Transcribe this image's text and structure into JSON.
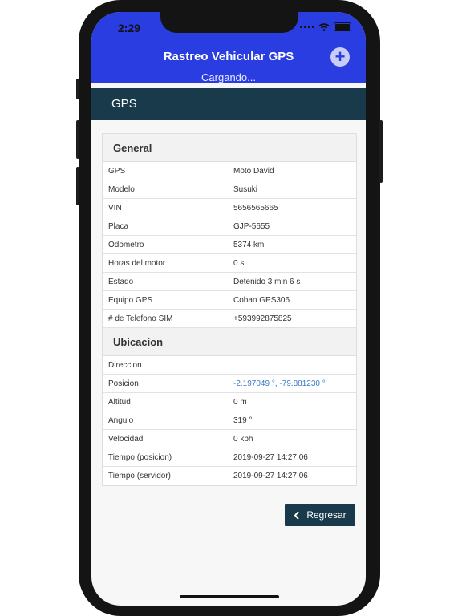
{
  "status_bar": {
    "time": "2:29"
  },
  "header": {
    "title": "Rastreo Vehicular GPS",
    "loading": "Cargando...",
    "add_icon": "plus-circle-icon"
  },
  "subheader": {
    "title": "GPS"
  },
  "sections": {
    "general": {
      "title": "General",
      "rows": [
        {
          "key": "GPS",
          "value": "Moto David"
        },
        {
          "key": "Modelo",
          "value": "Susuki"
        },
        {
          "key": "VIN",
          "value": "5656565665"
        },
        {
          "key": "Placa",
          "value": "GJP-5655"
        },
        {
          "key": "Odometro",
          "value": "5374 km"
        },
        {
          "key": "Horas del motor",
          "value": "0 s"
        },
        {
          "key": "Estado",
          "value": "Detenido 3 min 6 s"
        },
        {
          "key": "Equipo GPS",
          "value": "Coban GPS306"
        },
        {
          "key": "# de Telefono SIM",
          "value": "+593992875825"
        }
      ]
    },
    "ubicacion": {
      "title": "Ubicacion",
      "rows": [
        {
          "key": "Direccion",
          "value": ""
        },
        {
          "key": "Posicion",
          "value": "-2.197049 °, -79.881230 °"
        },
        {
          "key": "Altitud",
          "value": "0 m"
        },
        {
          "key": "Angulo",
          "value": "319 °"
        },
        {
          "key": "Velocidad",
          "value": "0 kph"
        },
        {
          "key": "Tiempo (posicion)",
          "value": "2019-09-27 14:27:06"
        },
        {
          "key": "Tiempo (servidor)",
          "value": "2019-09-27 14:27:06"
        }
      ]
    }
  },
  "back_button": {
    "label": "Regresar",
    "icon": "chevron-left-icon"
  },
  "colors": {
    "header": "#2a3de0",
    "subheader": "#183a4b",
    "link": "#3a78c9"
  }
}
